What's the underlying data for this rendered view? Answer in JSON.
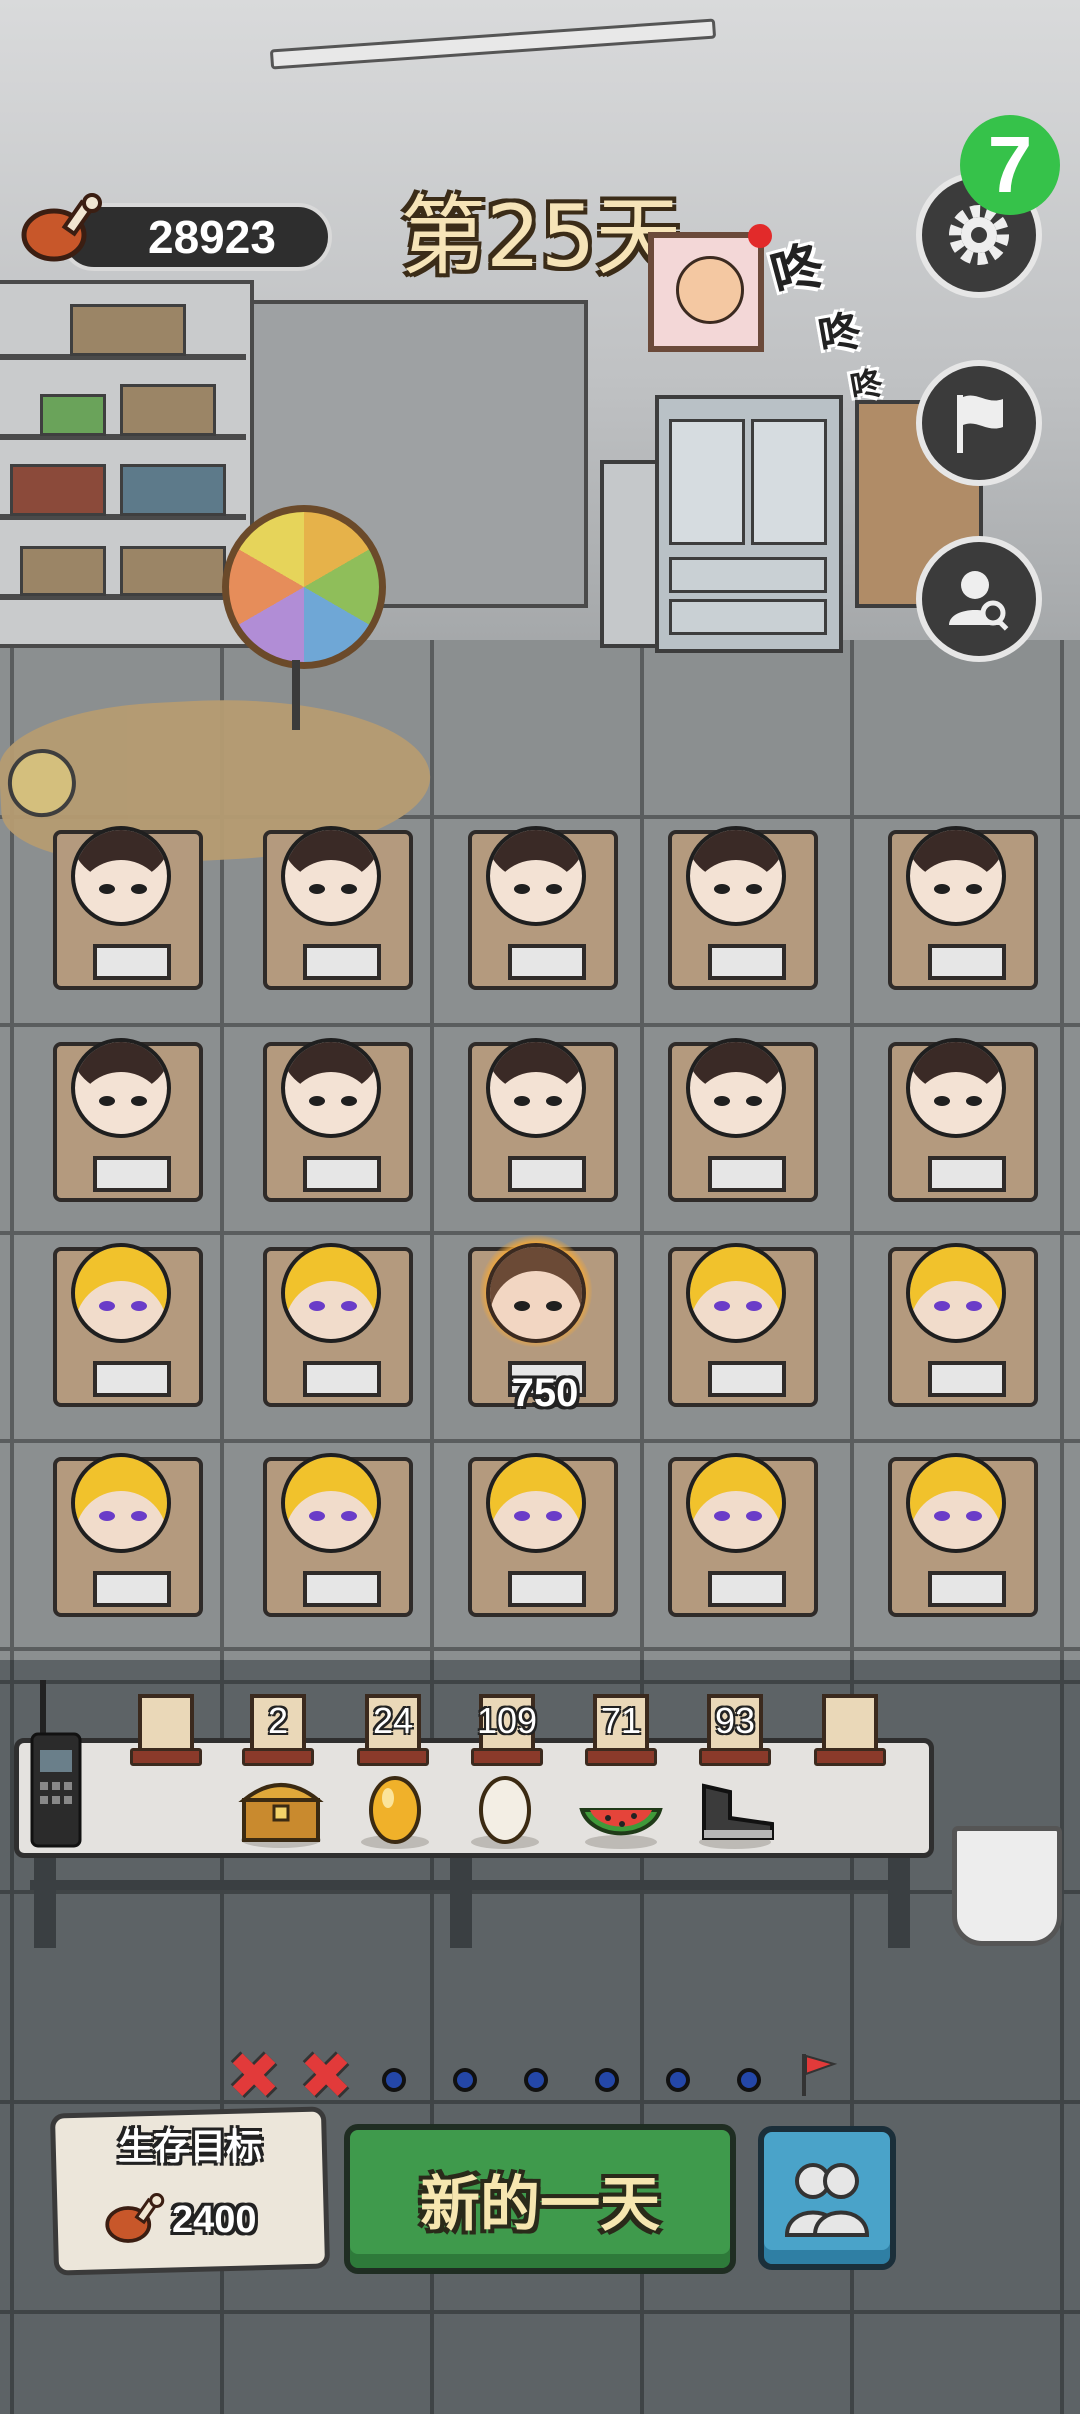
{
  "hud": {
    "resource_count": "28923",
    "day_label": "第25天",
    "sfx": [
      "咚",
      "咚",
      "咚"
    ]
  },
  "side_buttons": [
    {
      "icon": "gear-icon",
      "label": "settings"
    },
    {
      "icon": "flag-icon",
      "label": "flag"
    },
    {
      "icon": "user-search-icon",
      "label": "find-person"
    }
  ],
  "badge": {
    "value": "7",
    "color": "#36c24a"
  },
  "grid": {
    "rows": [
      [
        "girl",
        "girl",
        "girl",
        "girl",
        "girl"
      ],
      [
        "girl",
        "girl",
        "girl",
        "girl",
        "girl"
      ],
      [
        "blond",
        "blond",
        "monk",
        "blond",
        "blond"
      ],
      [
        "blond",
        "blond",
        "blond",
        "blond",
        "blond"
      ]
    ],
    "highlight_price": "750"
  },
  "inventory": {
    "slots": [
      {
        "count": "",
        "item": "empty"
      },
      {
        "count": "2",
        "item": "treasure-chest-icon"
      },
      {
        "count": "24",
        "item": "golden-egg-icon"
      },
      {
        "count": "109",
        "item": "egg-icon"
      },
      {
        "count": "71",
        "item": "watermelon-icon"
      },
      {
        "count": "93",
        "item": "boot-icon"
      },
      {
        "count": "",
        "item": "empty"
      }
    ]
  },
  "progress": {
    "failed": 2,
    "remaining_dots": 6,
    "goal_icon": "red-flag-icon"
  },
  "goal": {
    "title": "生存目标",
    "value": "2400"
  },
  "actions": {
    "new_day_label": "新的一天"
  },
  "colors": {
    "accent_green": "#3f9a4c",
    "accent_blue": "#4aa3c9",
    "danger_red": "#e23a3a"
  }
}
